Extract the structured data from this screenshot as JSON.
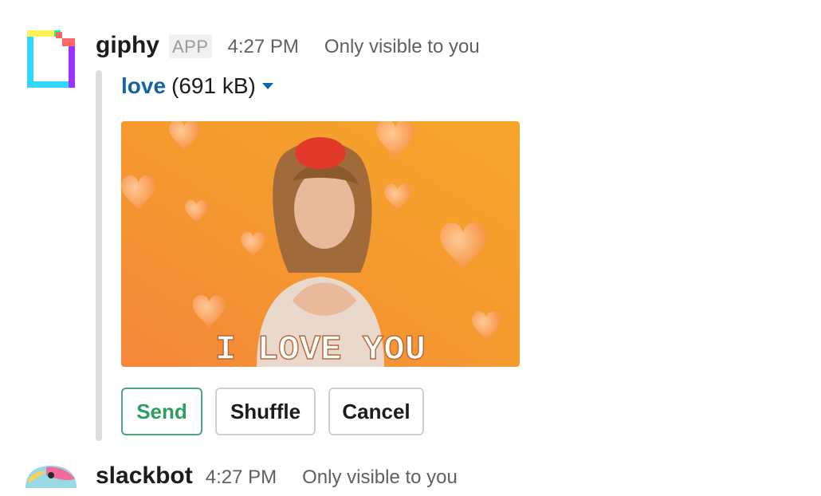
{
  "message": {
    "sender": "giphy",
    "badge": "APP",
    "time": "4:27 PM",
    "visibility": "Only visible to you",
    "attachment": {
      "title": "love",
      "size": "(691 kB)",
      "image_caption": "I LOVE YOU"
    },
    "buttons": {
      "send": "Send",
      "shuffle": "Shuffle",
      "cancel": "Cancel"
    }
  },
  "next_message": {
    "sender": "slackbot",
    "time": "4:27 PM",
    "visibility": "Only visible to you"
  },
  "colors": {
    "link": "#1264a3",
    "send_green": "#2f9d62",
    "gif_orange": "#f59a2f"
  },
  "icons": [
    "giphy-logo-icon",
    "caret-down-icon",
    "slackbot-avatar-icon"
  ]
}
